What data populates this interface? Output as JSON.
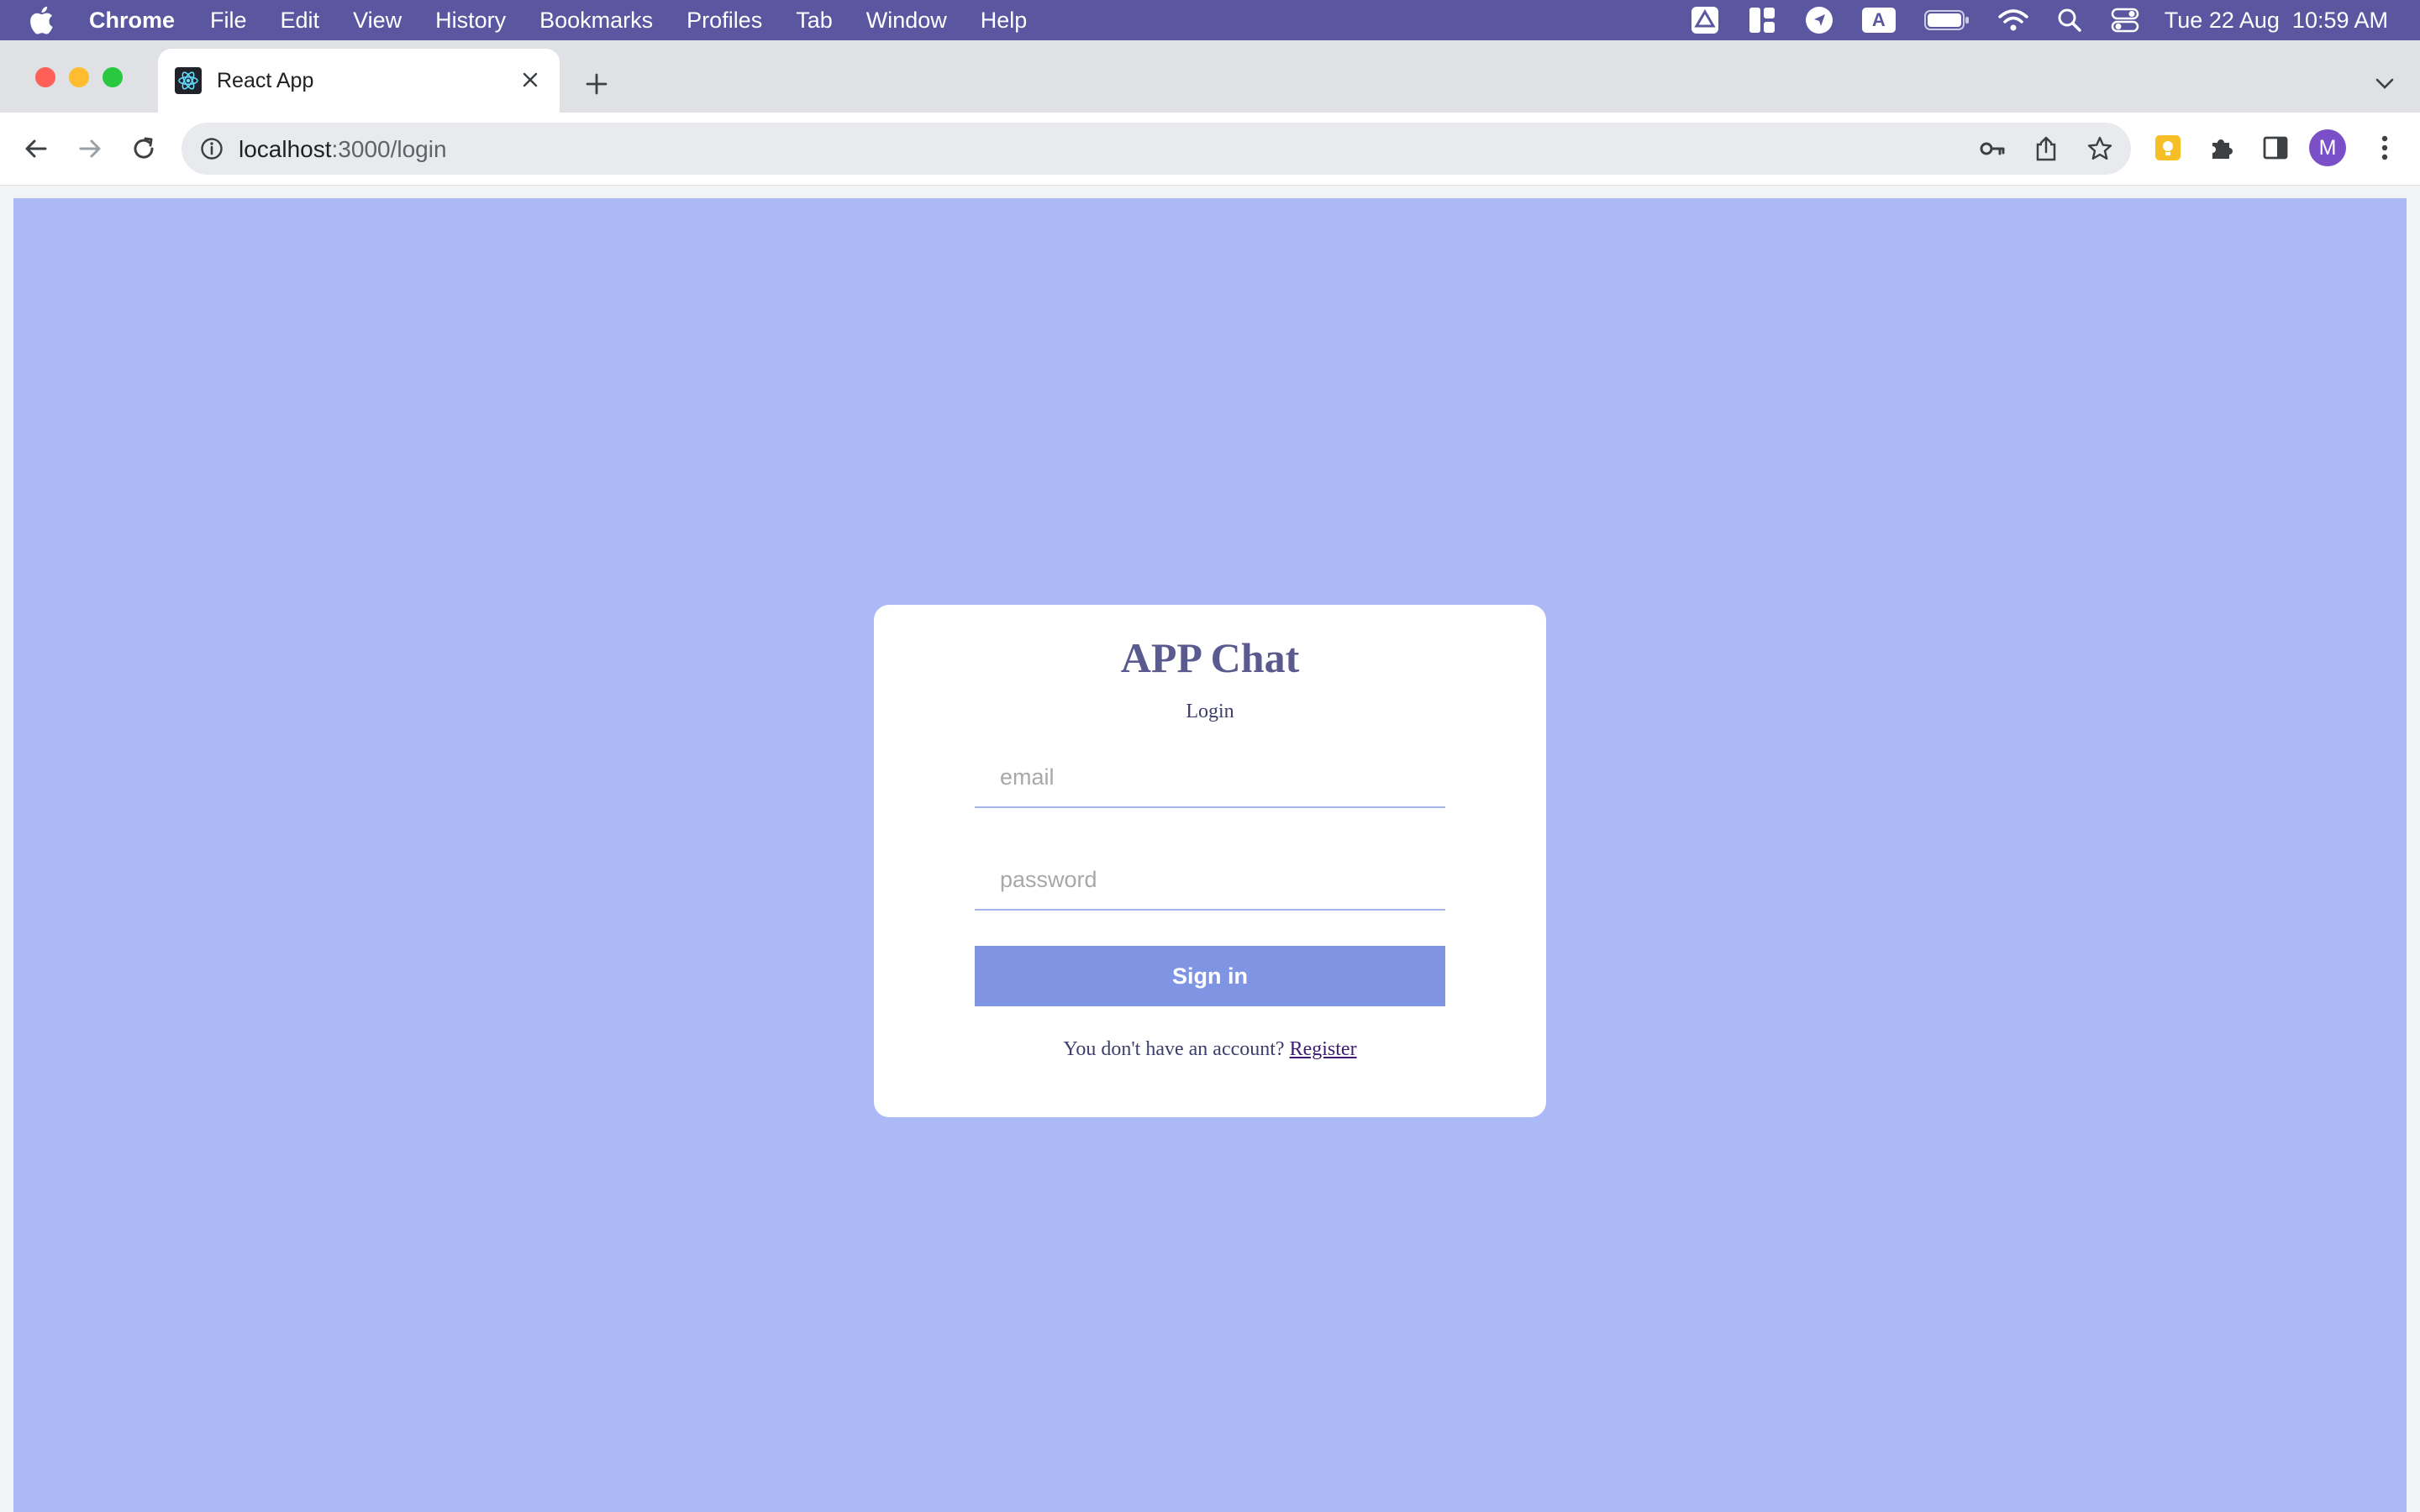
{
  "menubar": {
    "app_name": "Chrome",
    "items": [
      "File",
      "Edit",
      "View",
      "History",
      "Bookmarks",
      "Profiles",
      "Tab",
      "Window",
      "Help"
    ],
    "status_letter": "A",
    "date": "Tue 22 Aug",
    "time": "10:59 AM"
  },
  "tab": {
    "title": "React App"
  },
  "omnibox": {
    "host": "localhost",
    "path": ":3000/login"
  },
  "profile": {
    "initial": "M",
    "color": "#7a4fc7"
  },
  "page": {
    "background": "#abb9f7",
    "title": "APP Chat",
    "subtitle": "Login",
    "email_placeholder": "email",
    "password_placeholder": "password",
    "signin_label": "Sign in",
    "footer_prefix": "You don't have an account?",
    "register_label": "Register",
    "button_color": "#7f95e4"
  }
}
